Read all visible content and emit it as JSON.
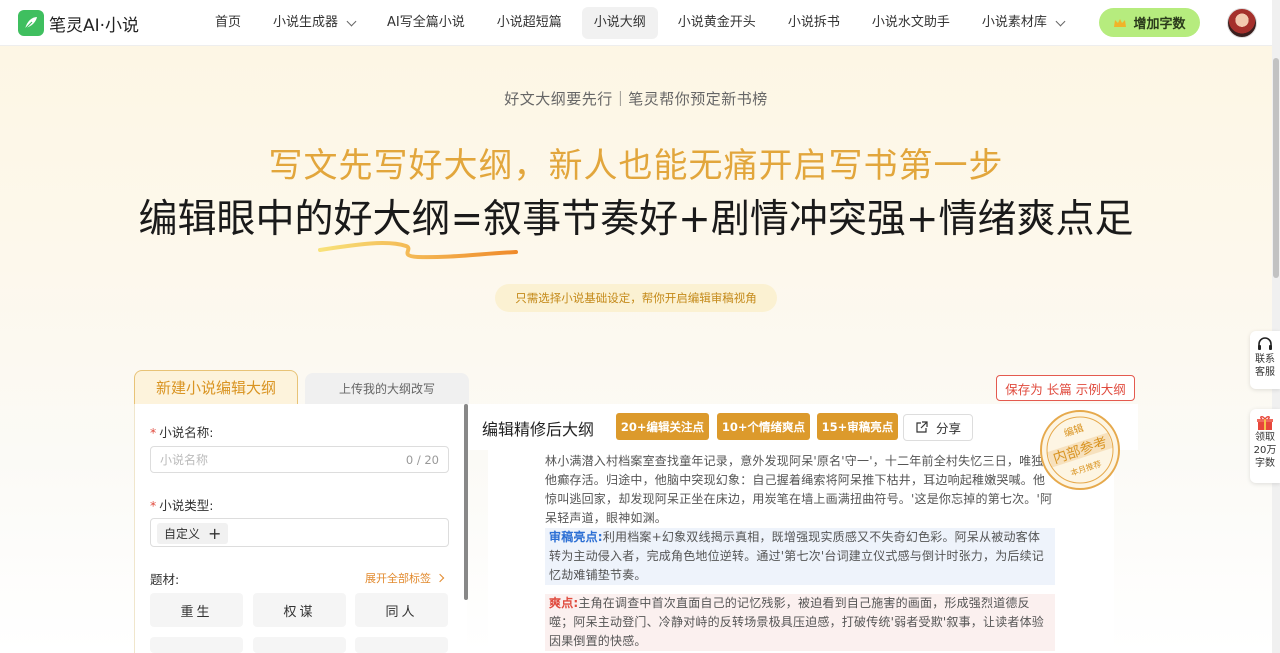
{
  "app": {
    "logo_text": "笔灵AI·小说"
  },
  "nav": {
    "items": [
      {
        "label": "首页",
        "dropdown": false,
        "active": false
      },
      {
        "label": "小说生成器",
        "dropdown": true,
        "active": false
      },
      {
        "label": "AI写全篇小说",
        "dropdown": false,
        "active": false
      },
      {
        "label": "小说超短篇",
        "dropdown": false,
        "active": false
      },
      {
        "label": "小说大纲",
        "dropdown": false,
        "active": true
      },
      {
        "label": "小说黄金开头",
        "dropdown": false,
        "active": false
      },
      {
        "label": "小说拆书",
        "dropdown": false,
        "active": false
      },
      {
        "label": "小说水文助手",
        "dropdown": false,
        "active": false
      },
      {
        "label": "小说素材库",
        "dropdown": true,
        "active": false
      }
    ],
    "add_words_label": "增加字数"
  },
  "hero": {
    "subtitle": "好文大纲要先行｜笔灵帮你预定新书榜",
    "headline1": "写文先写好大纲，新人也能无痛开启写书第一步",
    "headline2": "编辑眼中的好大纲=叙事节奏好+剧情冲突强+情绪爽点足",
    "hint": "只需选择小说基础设定，帮你开启编辑审稿视角"
  },
  "tabs": {
    "new_label": "新建小说编辑大纲",
    "upload_label": "上传我的大纲改写"
  },
  "save_example_label": "保存为 长篇 示例大纲",
  "form": {
    "name_label": "小说名称:",
    "name_placeholder": "小说名称",
    "name_counter": "0 / 20",
    "type_label": "小说类型:",
    "type_chip": "自定义",
    "genre_label": "题材:",
    "expand_label": "展开全部标签",
    "genres": [
      "重生",
      "权谋",
      "同人"
    ]
  },
  "preview": {
    "title": "编辑精修后大纲",
    "badges": [
      "20+编辑关注点",
      "10+个情绪爽点",
      "15+审稿亮点"
    ],
    "share_label": "分享",
    "stamp_top": "编辑",
    "stamp_main": "内部参考",
    "stamp_bottom": "本月推荐",
    "para1": "林小满潜入村档案室查找童年记录，意外发现阿呆'原名'守一'，十二年前全村失忆三日，唯独他癫存活。归途中，他脑中突现幻象：自己握着绳索将阿呆推下枯井，耳边响起稚嫩哭喊。他惊叫逃回家，却发现阿呆正坐在床边，用炭笔在墙上画满扭曲符号。'这是你忘掉的第七次。'阿呆轻声道，眼神如渊。",
    "para2_tag": "审稿亮点:",
    "para2": "利用档案+幻象双线揭示真相，既增强现实质感又不失奇幻色彩。阿呆从被动客体转为主动侵入者，完成角色地位逆转。通过'第七次'台词建立仪式感与倒计时张力，为后续记忆劫难铺垫节奏。",
    "para3_tag": "爽点:",
    "para3": "主角在调查中首次直面自己的记忆残影，被迫看到自己施害的画面，形成强烈道德反噬；阿呆主动登门、冷静对峙的反转场景极具压迫感，打破传统'弱者受欺'叙事，让读者体验因果倒置的快感。"
  },
  "side": {
    "service_label": "联系客服",
    "gift_label": "领取20万字数"
  },
  "colors": {
    "accent_gold": "#dc9a2c",
    "accent_red": "#e04b3e",
    "add_words_bg": "#b6ec7e"
  }
}
